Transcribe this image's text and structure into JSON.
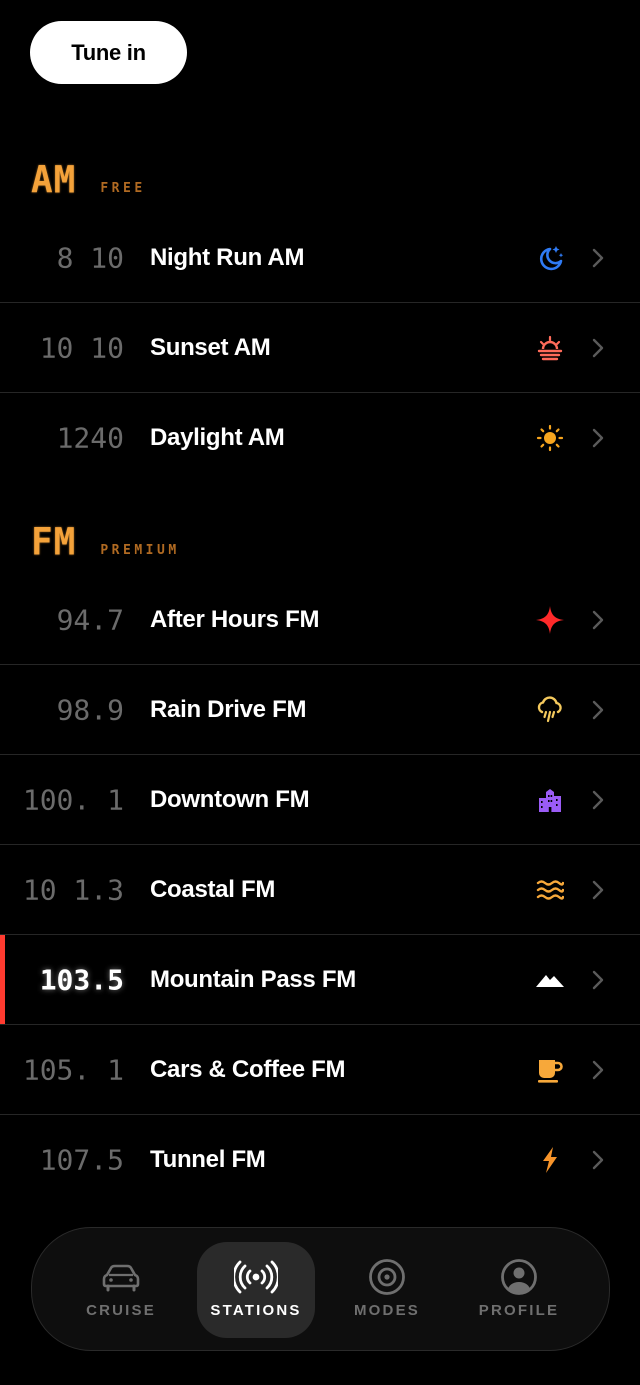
{
  "tune_in_label": "Tune in",
  "bands": [
    {
      "name": "AM",
      "tier": "FREE",
      "stations": [
        {
          "freq": "8 10",
          "name": "Night Run AM",
          "icon": "moon-stars-icon",
          "color": "#2f7bf5"
        },
        {
          "freq": "10 10",
          "name": "Sunset AM",
          "icon": "sunset-icon",
          "color": "#ff6b5a"
        },
        {
          "freq": "1240",
          "name": "Daylight AM",
          "icon": "sun-icon",
          "color": "#f7a51e"
        }
      ]
    },
    {
      "name": "FM",
      "tier": "PREMIUM",
      "stations": [
        {
          "freq": "94.7",
          "name": "After Hours FM",
          "icon": "sparkle-icon",
          "color": "#ff2a2a"
        },
        {
          "freq": "98.9",
          "name": "Rain Drive FM",
          "icon": "rain-cloud-icon",
          "color": "#f4c95d"
        },
        {
          "freq": "100. 1",
          "name": "Downtown FM",
          "icon": "buildings-icon",
          "color": "#9b5cf6"
        },
        {
          "freq": "10 1.3",
          "name": "Coastal FM",
          "icon": "waves-icon",
          "color": "#f7a83a"
        },
        {
          "freq": "103.5",
          "name": "Mountain Pass FM",
          "icon": "mountain-icon",
          "color": "#ffffff",
          "active": true
        },
        {
          "freq": "105. 1",
          "name": "Cars & Coffee FM",
          "icon": "coffee-icon",
          "color": "#f7a83a"
        },
        {
          "freq": "107.5",
          "name": "Tunnel FM",
          "icon": "lightning-icon",
          "color": "#f7942a"
        }
      ]
    }
  ],
  "nav": [
    {
      "label": "CRUISE",
      "icon": "car-icon"
    },
    {
      "label": "STATIONS",
      "icon": "broadcast-icon",
      "active": true
    },
    {
      "label": "MODES",
      "icon": "target-icon"
    },
    {
      "label": "PROFILE",
      "icon": "profile-icon"
    }
  ]
}
